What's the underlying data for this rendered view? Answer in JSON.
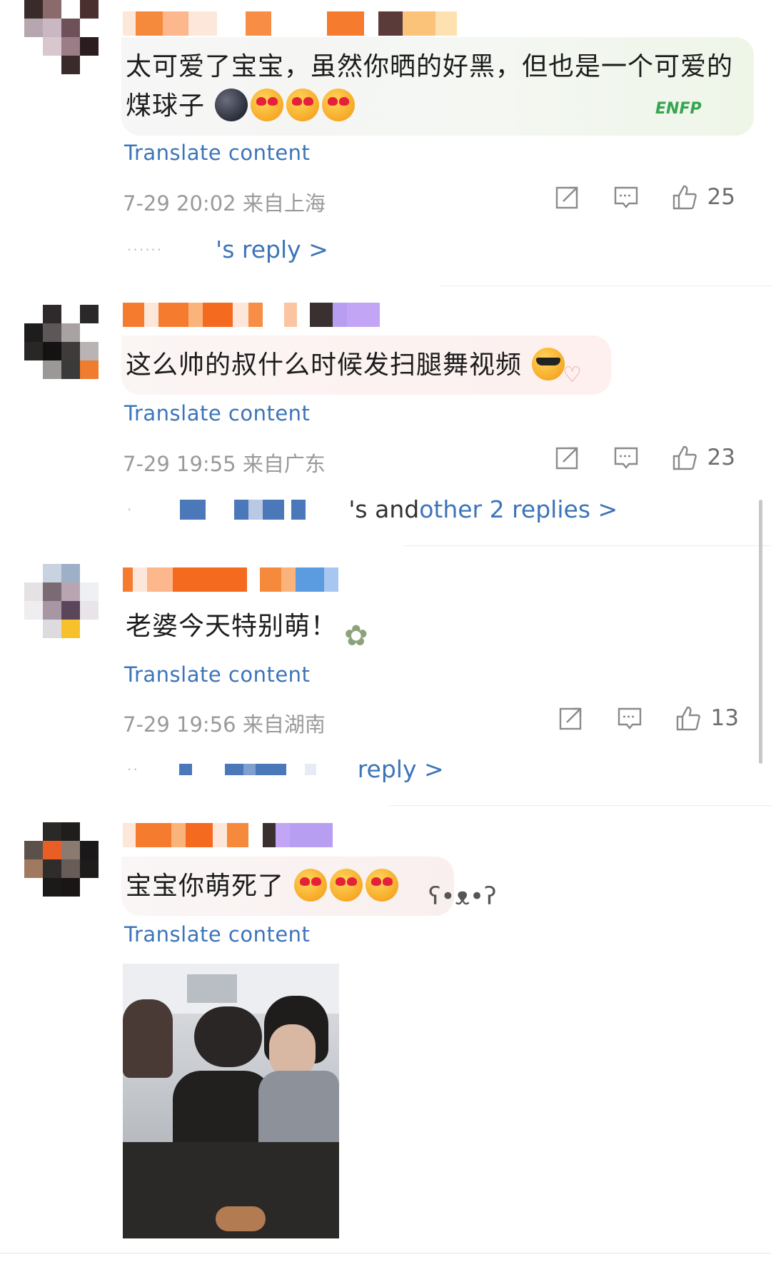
{
  "comments": [
    {
      "text": "太可爱了宝宝，虽然你晒的好黑，但也是一个可爱的煤球子",
      "emojis": [
        "new-moon-face",
        "heart-eyes",
        "heart-eyes",
        "heart-eyes"
      ],
      "decoration": "ENFP",
      "translate": "Translate content",
      "time": "7-29 20:02",
      "location": "来自上海",
      "likes": "25",
      "reply_text": "'s reply >"
    },
    {
      "text": "这么帅的叔什么时候发扫腿舞视频",
      "emojis": [
        "sunglasses-face"
      ],
      "translate": "Translate content",
      "time": "7-29 19:55",
      "location": "来自广东",
      "likes": "23",
      "reply_prefix": "'s and ",
      "reply_text": "other 2 replies >"
    },
    {
      "text": "老婆今天特别萌！",
      "emojis": [],
      "translate": "Translate content",
      "time": "7-29 19:56",
      "location": "来自湖南",
      "likes": "13",
      "reply_text": "reply >"
    },
    {
      "text": "宝宝你萌死了",
      "emojis": [
        "heart-eyes",
        "heart-eyes",
        "heart-eyes"
      ],
      "translate": "Translate content"
    }
  ],
  "colors": {
    "link": "#3c74b8",
    "meta": "#9a9a9a",
    "divider": "#ececec"
  }
}
